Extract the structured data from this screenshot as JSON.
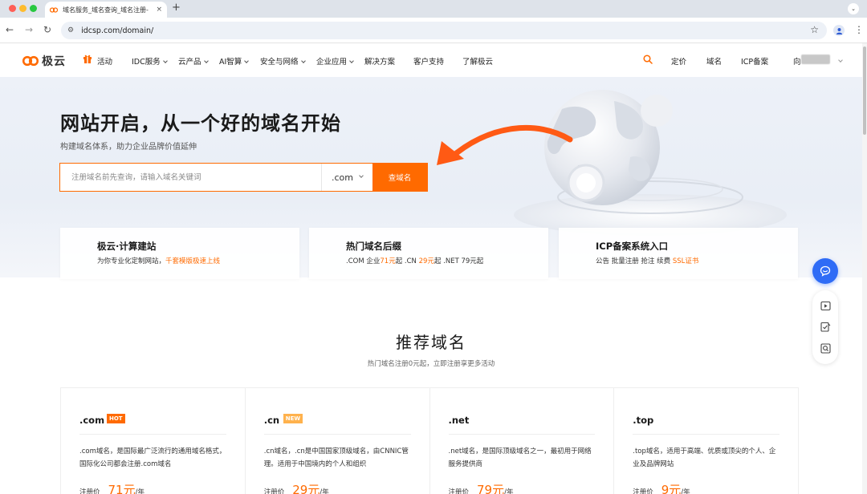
{
  "browser": {
    "tab_title": "域名服务_域名查询_域名注册-",
    "tab_close": "×",
    "new_tab": "+",
    "url": "idcsp.com/domain/"
  },
  "header": {
    "logo_text": "极云",
    "nav": [
      {
        "label": "活动",
        "has_dropdown": false
      },
      {
        "label": "IDC服务",
        "has_dropdown": true
      },
      {
        "label": "云产品",
        "has_dropdown": true
      },
      {
        "label": "AI智算",
        "has_dropdown": true
      },
      {
        "label": "安全与网络",
        "has_dropdown": true
      },
      {
        "label": "企业应用",
        "has_dropdown": true
      },
      {
        "label": "解决方案",
        "has_dropdown": false
      },
      {
        "label": "客户支持",
        "has_dropdown": false
      },
      {
        "label": "了解极云",
        "has_dropdown": false
      }
    ],
    "right_links": [
      "定价",
      "域名",
      "ICP备案"
    ],
    "user_prefix": "向"
  },
  "hero": {
    "title": "网站开启，从一个好的域名开始",
    "subtitle": "构建域名体系，助力企业品牌价值延伸",
    "search_placeholder": "注册域名前先查询，请输入域名关键词",
    "tld_selected": ".com",
    "search_button": "查域名"
  },
  "info_cards": [
    {
      "title": "极云·计算建站",
      "desc_prefix": "为你专业化定制网站，",
      "desc_highlight": "千套模版极速上线",
      "desc_suffix": ""
    },
    {
      "title": "热门域名后缀",
      "desc_parts": [
        ".COM 企业",
        "71元",
        "起 .CN ",
        "29元",
        "起 .NET 79元起"
      ]
    },
    {
      "title": "ICP备案系统入口",
      "desc_prefix": "公告 批量注册 抢注 续费 ",
      "desc_highlight": "SSL证书",
      "desc_suffix": ""
    }
  ],
  "recommend": {
    "title": "推荐域名",
    "subtitle": "热门域名注册0元起，立即注册享更多活动",
    "price_label": "注册价",
    "unit": "/年",
    "domains": [
      {
        "name": ".com",
        "badge": "HOT",
        "desc": ".com域名，是国际最广泛流行的通用域名格式，国际化公司都会注册.com域名",
        "price": "71元"
      },
      {
        "name": ".cn",
        "badge": "NEW",
        "desc": ".cn域名，.cn是中国国家顶级域名，由CNNIC管理。适用于中国境内的个人和组织",
        "price": "29元"
      },
      {
        "name": ".net",
        "badge": "",
        "desc": ".net域名，是国际顶级域名之一，最初用于网络服务提供商",
        "price": "79元"
      },
      {
        "name": ".top",
        "badge": "",
        "desc": ".top域名，适用于高端、优质或顶尖的个人、企业及品牌网站",
        "price": "9元"
      }
    ]
  },
  "colors": {
    "accent": "#ff6a00",
    "float_chat": "#2f6cf6"
  },
  "icons": {
    "floating": [
      "chat-icon",
      "video-icon",
      "edit-check-icon",
      "search-doc-icon"
    ]
  }
}
